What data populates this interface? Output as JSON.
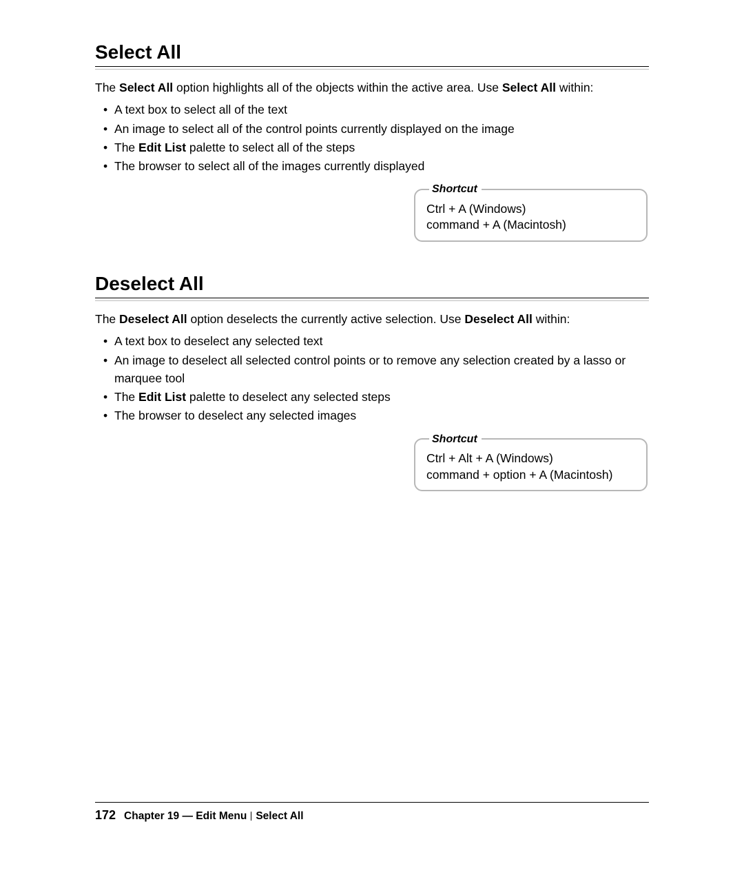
{
  "sections": [
    {
      "heading": "Select All",
      "intro_pre": "The ",
      "intro_bold1": "Select All",
      "intro_mid": " option highlights all of the objects within the active area. Use ",
      "intro_bold2": "Select All",
      "intro_post": " within:",
      "list": [
        {
          "pre": "A text box to select all of the text",
          "bold": "",
          "post": ""
        },
        {
          "pre": "An image to select all of the control points currently displayed on the image",
          "bold": "",
          "post": ""
        },
        {
          "pre": "The ",
          "bold": "Edit List",
          "post": " palette to select all of the steps"
        },
        {
          "pre": "The browser to select all of the images currently displayed",
          "bold": "",
          "post": ""
        }
      ],
      "shortcut_legend": "Shortcut",
      "shortcut_line1": "Ctrl + A (Windows)",
      "shortcut_line2": "command + A (Macintosh)"
    },
    {
      "heading": "Deselect All",
      "intro_pre": "The ",
      "intro_bold1": "Deselect All",
      "intro_mid": " option deselects the currently active selection. Use ",
      "intro_bold2": "Deselect All",
      "intro_post": " within:",
      "list": [
        {
          "pre": "A text box to deselect any selected text",
          "bold": "",
          "post": ""
        },
        {
          "pre": "An image to deselect all selected control points or to remove any selection created by a lasso or marquee tool",
          "bold": "",
          "post": ""
        },
        {
          "pre": "The ",
          "bold": "Edit List",
          "post": " palette to deselect any selected steps"
        },
        {
          "pre": "The browser to deselect any selected images",
          "bold": "",
          "post": ""
        }
      ],
      "shortcut_legend": "Shortcut",
      "shortcut_line1": "Ctrl + Alt + A (Windows)",
      "shortcut_line2": "command + option + A (Macintosh)"
    }
  ],
  "footer": {
    "page_number": "172",
    "chapter": "Chapter 19 — Edit Menu",
    "topic": "Select All"
  }
}
